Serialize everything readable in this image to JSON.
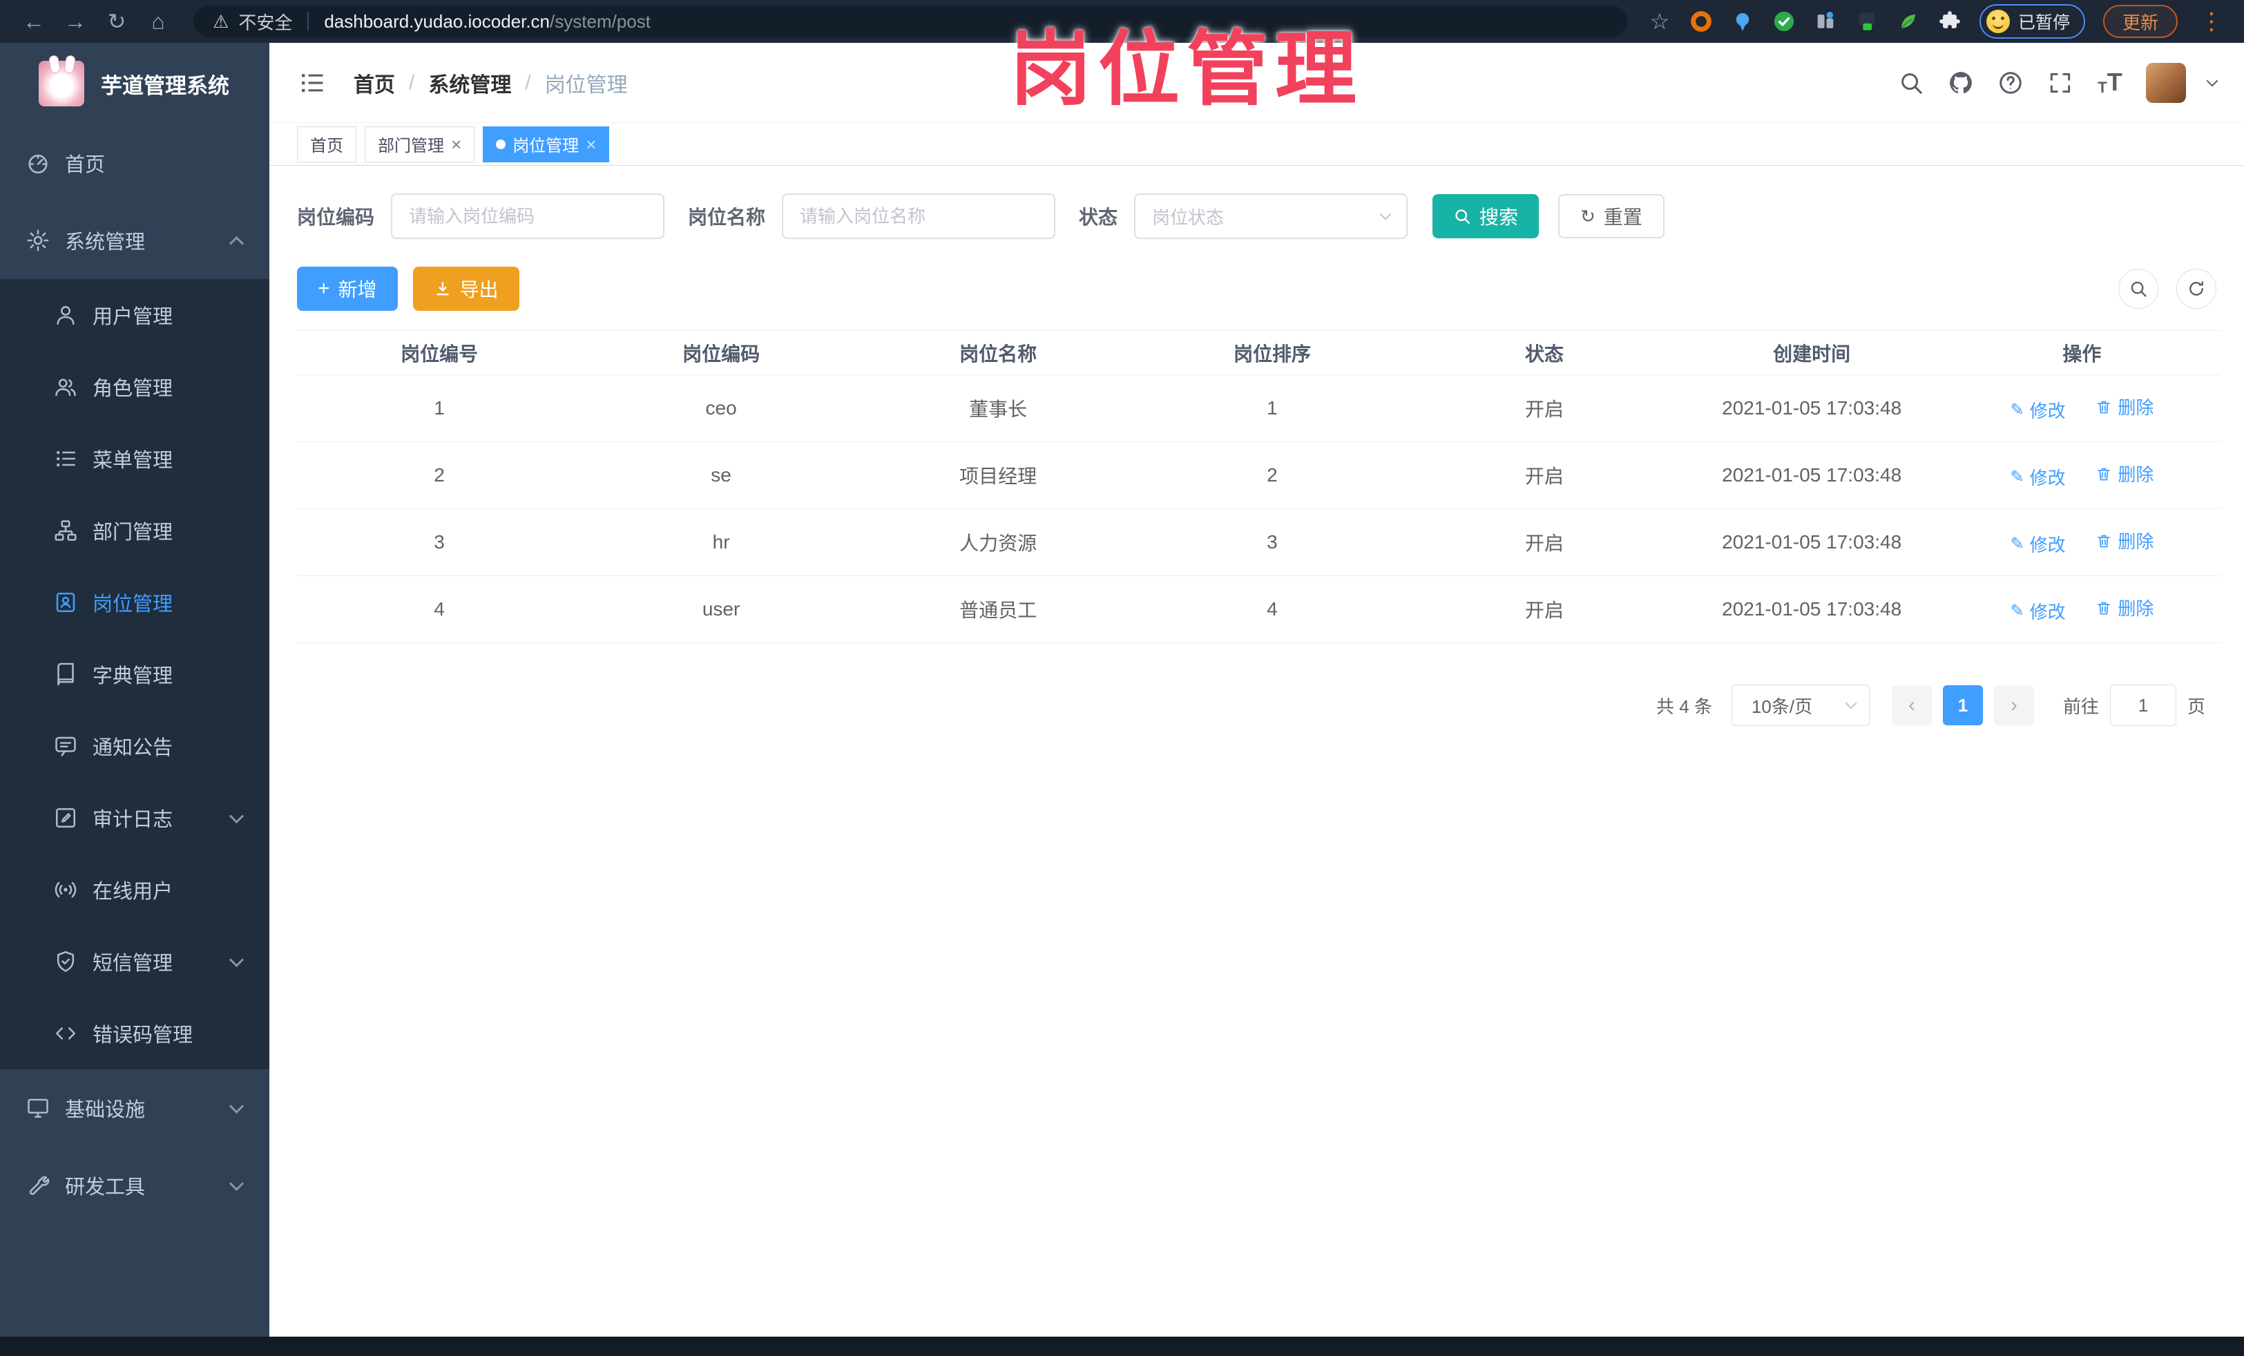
{
  "browser": {
    "security_label": "不安全",
    "url_host": "dashboard.yudao.iocoder.cn",
    "url_path": "/system/post",
    "profile_chip": "已暂停",
    "update_button": "更新"
  },
  "watermark": "岗位管理",
  "sidebar": {
    "logo_title": "芋道管理系统",
    "items": [
      {
        "label": "首页"
      },
      {
        "label": "系统管理"
      },
      {
        "label": "用户管理"
      },
      {
        "label": "角色管理"
      },
      {
        "label": "菜单管理"
      },
      {
        "label": "部门管理"
      },
      {
        "label": "岗位管理"
      },
      {
        "label": "字典管理"
      },
      {
        "label": "通知公告"
      },
      {
        "label": "审计日志"
      },
      {
        "label": "在线用户"
      },
      {
        "label": "短信管理"
      },
      {
        "label": "错误码管理"
      },
      {
        "label": "基础设施"
      },
      {
        "label": "研发工具"
      }
    ]
  },
  "breadcrumb": {
    "items": [
      "首页",
      "系统管理",
      "岗位管理"
    ],
    "separator": "/"
  },
  "tabs": [
    {
      "label": "首页"
    },
    {
      "label": "部门管理"
    },
    {
      "label": "岗位管理"
    }
  ],
  "filters": {
    "code_label": "岗位编码",
    "code_placeholder": "请输入岗位编码",
    "name_label": "岗位名称",
    "name_placeholder": "请输入岗位名称",
    "status_label": "状态",
    "status_placeholder": "岗位状态",
    "search_button": "搜索",
    "reset_button": "重置"
  },
  "toolbar": {
    "add_button": "新增",
    "export_button": "导出"
  },
  "table": {
    "columns": [
      "岗位编号",
      "岗位编码",
      "岗位名称",
      "岗位排序",
      "状态",
      "创建时间",
      "操作"
    ],
    "rows": [
      {
        "id": "1",
        "code": "ceo",
        "name": "董事长",
        "sort": "1",
        "status": "开启",
        "created": "2021-01-05 17:03:48"
      },
      {
        "id": "2",
        "code": "se",
        "name": "项目经理",
        "sort": "2",
        "status": "开启",
        "created": "2021-01-05 17:03:48"
      },
      {
        "id": "3",
        "code": "hr",
        "name": "人力资源",
        "sort": "3",
        "status": "开启",
        "created": "2021-01-05 17:03:48"
      },
      {
        "id": "4",
        "code": "user",
        "name": "普通员工",
        "sort": "4",
        "status": "开启",
        "created": "2021-01-05 17:03:48"
      }
    ],
    "edit_label": "修改",
    "delete_label": "删除"
  },
  "pagination": {
    "total": "共 4 条",
    "page_size": "10条/页",
    "current_page": "1",
    "goto_label": "前往",
    "goto_value": "1",
    "page_unit": "页"
  },
  "glyphs": {
    "back": "←",
    "forward": "→",
    "reload": "↻",
    "home": "⌂",
    "warning": "⚠",
    "star": "☆",
    "kebab": "⋮",
    "plus": "+",
    "edit": "✎",
    "refresh": "↻",
    "close": "×",
    "font_letter": "T"
  },
  "colors": {
    "accent": "#409EFF",
    "search_button": "#17B3A6",
    "export_button": "#F0A020",
    "watermark": "#F2415C",
    "sidebar_bg": "#304156",
    "submenu_bg": "#1F2D3D"
  }
}
